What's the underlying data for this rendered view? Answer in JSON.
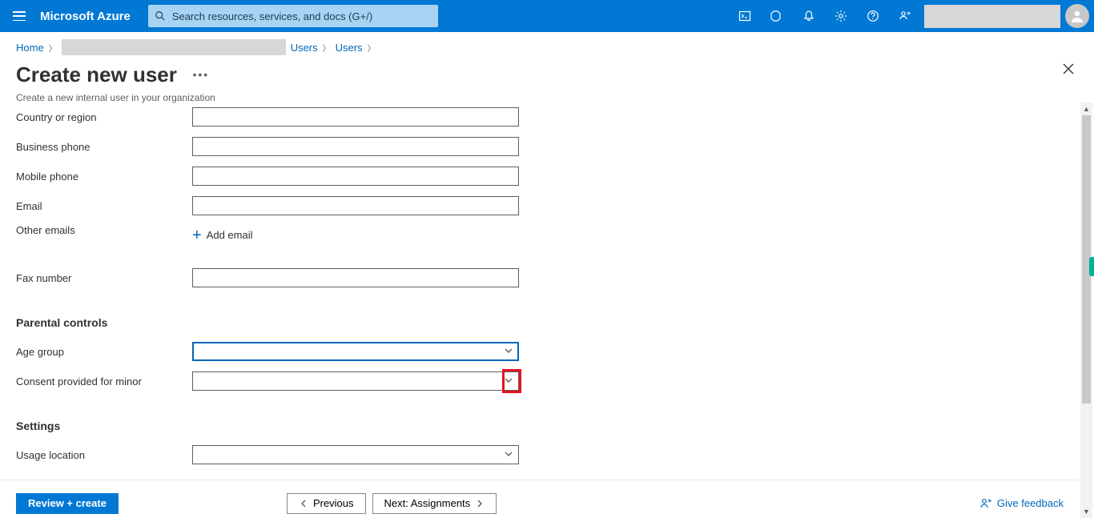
{
  "brand": "Microsoft Azure",
  "search": {
    "placeholder": "Search resources, services, and docs (G+/)"
  },
  "breadcrumbs": {
    "home": "Home",
    "users1": "Users",
    "users2": "Users"
  },
  "page": {
    "title": "Create new user",
    "subtitle": "Create a new internal user in your organization"
  },
  "labels": {
    "country": "Country or region",
    "bizphone": "Business phone",
    "mobile": "Mobile phone",
    "email": "Email",
    "otheremails": "Other emails",
    "addemail": "Add email",
    "fax": "Fax number",
    "parental_hdr": "Parental controls",
    "agegroup": "Age group",
    "consent": "Consent provided for minor",
    "settings_hdr": "Settings",
    "usageloc": "Usage location"
  },
  "values": {
    "country": "",
    "bizphone": "",
    "mobile": "",
    "email": "",
    "fax": "",
    "agegroup": "",
    "consent": "",
    "usageloc": ""
  },
  "buttons": {
    "review": "Review + create",
    "previous": "Previous",
    "next": "Next: Assignments",
    "feedback": "Give feedback"
  }
}
